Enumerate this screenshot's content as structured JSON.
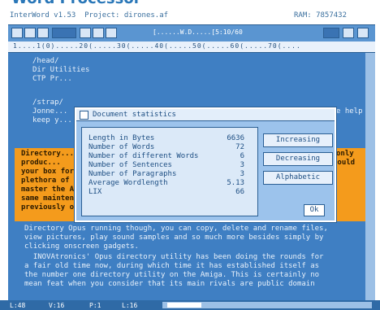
{
  "headline": "Word Processor",
  "titlebar": {
    "left": "InterWord v1.53  Project: dirones.af",
    "right": "RAM: 7857432"
  },
  "toolbar": {
    "field_text": "[......W.D.....[5:10/60"
  },
  "ruler": {
    "text": "1....1(0).....20(.....30(.....40(.....50(.....60(.....70(...."
  },
  "document": {
    "lines_top": [
      "/head/",
      "Dir Utilities",
      "CTP Pr...",
      "",
      "/strap/",
      "Jonne...",
      "keep y..."
    ],
    "right_fragment": "e help",
    "highlight_lines": [
      "Directory...",
      "produc...",
      "your box for your Amiga. Unless you enjoy torturing yourself with the",
      "plethora of complicated commands that must be learnt to operate to",
      "master the Amiga's Shell, a directory utility lets you perform the",
      "same maintenance and general disk house keeping chores that were",
      "previously only possible through the Shell. With a program like"
    ],
    "highlight_right": [
      "only",
      "could"
    ],
    "lines_bottom": [
      "Directory Opus running though, you can copy, delete and rename files,",
      "view pictures, play sound samples and so much more besides simply by",
      "clicking onscreen gadgets.",
      "  INOVAtronics' Opus directory utility has been doing the rounds for",
      "a fair old time now, during which time it has established itself as",
      "the number one directory utility on the Amiga. This is certainly no",
      "mean feat when you consider that its main rivals are public domain"
    ]
  },
  "dialog": {
    "title": "Document statistics",
    "stats": [
      {
        "label": "Length in Bytes",
        "value": "6636"
      },
      {
        "label": "Number of Words",
        "value": "72"
      },
      {
        "label": "Number of different Words",
        "value": "6"
      },
      {
        "label": "Number of Sentences",
        "value": "3"
      },
      {
        "label": "Number of Paragraphs",
        "value": "3"
      },
      {
        "label": "Average Wordlength",
        "value": "5.13"
      },
      {
        "label": "LIX",
        "value": "66"
      }
    ],
    "buttons": {
      "increasing": "Increasing",
      "decreasing": "Decreasing",
      "alphabetic": "Alphabetic",
      "ok": "Ok"
    }
  },
  "statusbar": {
    "line": "L:48",
    "col": "V:16",
    "page": "P:1",
    "mode": "L:16"
  },
  "colors": {
    "document_bg": "#3f7fc3",
    "highlight": "#f49b1c",
    "dialog_bg": "#9cc3ec"
  }
}
